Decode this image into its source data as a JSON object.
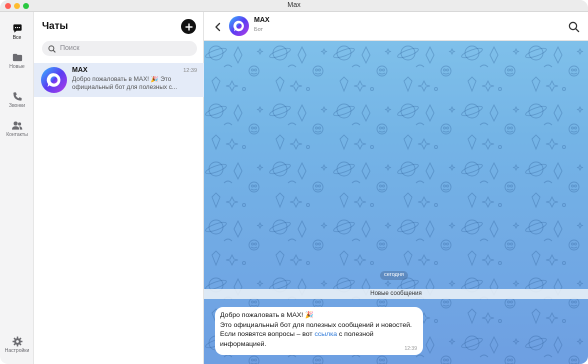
{
  "window": {
    "title": "Max"
  },
  "rail": {
    "items": [
      {
        "label": "Все",
        "icon": "chat-bubbles-icon",
        "active": true
      },
      {
        "label": "Новые",
        "icon": "folder-icon",
        "active": false
      },
      {
        "label": "Звонки",
        "icon": "phone-icon",
        "active": false
      },
      {
        "label": "Контакты",
        "icon": "contacts-icon",
        "active": false
      },
      {
        "label": "Настройки",
        "icon": "gear-icon",
        "active": false
      }
    ]
  },
  "chatlist": {
    "title": "Чаты",
    "compose_icon": "plus-icon",
    "search_placeholder": "Поиск",
    "chats": [
      {
        "name": "MAX",
        "time": "12:39",
        "preview": "Добро пожаловать в MAX! 🎉 Это официальный бот для полезных с..."
      }
    ]
  },
  "conversation": {
    "name": "MAX",
    "subtitle": "Бот",
    "date_chip": "сегодня",
    "new_messages": "Новые сообщения",
    "message": {
      "line1": "Добро пожаловать в MAX! 🎉",
      "line2_part1": "Это официальный бот для полезных сообщений и новостей. Если появятся вопросы – вот ",
      "link": "ссылка",
      "line2_part2": " с полезной информацией.",
      "time": "12:39"
    }
  },
  "colors": {
    "accent": "#2f7ad9",
    "selected_row": "#e4ebf8",
    "wallpaper_top": "#7fc0ea",
    "wallpaper_bottom": "#6e9fe2"
  }
}
